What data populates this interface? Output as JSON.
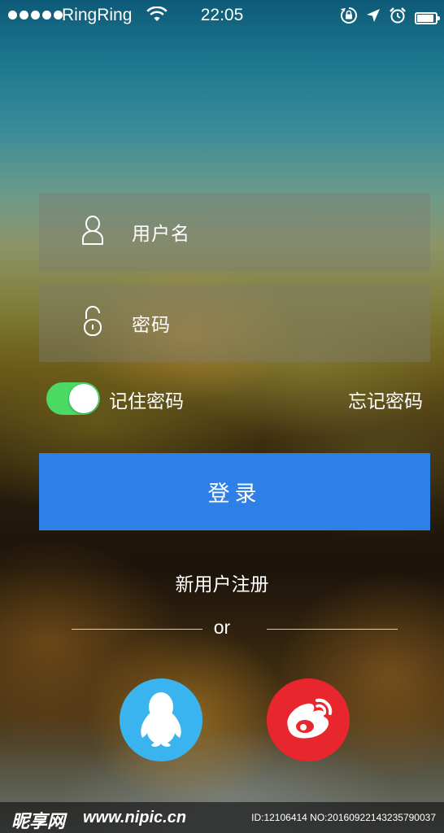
{
  "status_bar": {
    "carrier": "RingRing",
    "time": "22:05",
    "battery_level": 0.9,
    "icons": [
      "signal-dots-icon",
      "wifi-icon",
      "rotation-lock-icon",
      "location-arrow-icon",
      "alarm-icon",
      "battery-icon"
    ]
  },
  "login_form": {
    "username_placeholder": "用户名",
    "password_placeholder": "密码",
    "remember_label": "记住密码",
    "remember_enabled": true,
    "forgot_label": "忘记密码",
    "login_button_label": "登录"
  },
  "register": {
    "label": "新用户注册"
  },
  "divider": {
    "label": "or"
  },
  "social_login": [
    {
      "name": "qq",
      "icon": "qq-penguin-icon",
      "color": "#39b4ef"
    },
    {
      "name": "weibo",
      "icon": "weibo-icon",
      "color": "#e8262d"
    }
  ],
  "watermark": {
    "logo": "昵享网",
    "url": "www.nipic.cn",
    "id_text": "ID:12106414 NO:20160922143235790037"
  },
  "colors": {
    "accent": "#2e7fe6",
    "toggle_on": "#4cd964"
  }
}
